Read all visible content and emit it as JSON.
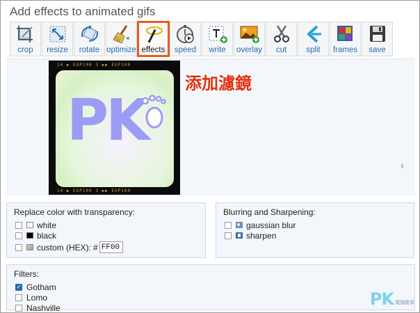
{
  "page": {
    "title": "Add effects to animated gifs"
  },
  "toolbar": {
    "tools": [
      {
        "id": "crop",
        "label": "crop",
        "icon": "crop-icon"
      },
      {
        "id": "resize",
        "label": "resize",
        "icon": "resize-icon"
      },
      {
        "id": "rotate",
        "label": "rotate",
        "icon": "rotate-icon"
      },
      {
        "id": "optimize",
        "label": "optimize",
        "icon": "broom-icon"
      },
      {
        "id": "effects",
        "label": "effects",
        "icon": "magic-wand-icon",
        "active": true
      },
      {
        "id": "speed",
        "label": "speed",
        "icon": "stopwatch-icon"
      },
      {
        "id": "write",
        "label": "write",
        "icon": "text-icon"
      },
      {
        "id": "overlay",
        "label": "overlay",
        "icon": "image-overlay-icon"
      },
      {
        "id": "cut",
        "label": "cut",
        "icon": "scissors-icon"
      },
      {
        "id": "split",
        "label": "split",
        "icon": "split-icon"
      },
      {
        "id": "frames",
        "label": "frames",
        "icon": "frames-icon"
      },
      {
        "id": "save",
        "label": "save",
        "icon": "floppy-disk-icon"
      }
    ],
    "accent_color": "#ea5a28"
  },
  "preview": {
    "gif_text": "PK",
    "film_top": "14 ▶ EUP100    3 ▶▶ EUP100",
    "film_bot": "14 ▶ EUP100    3 ▶▶ EUP100",
    "annotation": "添加濾鏡",
    "annotation_color": "#e03012"
  },
  "transparency": {
    "title": "Replace color with transparency:",
    "options": [
      {
        "label": "white",
        "swatch": "#ffffff",
        "checked": false
      },
      {
        "label": "black",
        "swatch": "#000000",
        "checked": false
      },
      {
        "label": "custom (HEX):",
        "swatch": "#c8d88a",
        "checked": false
      }
    ],
    "hash": "#",
    "hex_value": "FF00"
  },
  "blur": {
    "title": "Blurring and Sharpening:",
    "options": [
      {
        "label": "gaussian blur",
        "checked": false
      },
      {
        "label": "sharpen",
        "checked": false
      }
    ]
  },
  "filters": {
    "title": "Filters:",
    "options": [
      {
        "label": "Gotham",
        "checked": true
      },
      {
        "label": "Lomo",
        "checked": false
      },
      {
        "label": "Nashville",
        "checked": false
      }
    ]
  },
  "watermark": {
    "big": "PK",
    "small": "電腦趣事"
  }
}
